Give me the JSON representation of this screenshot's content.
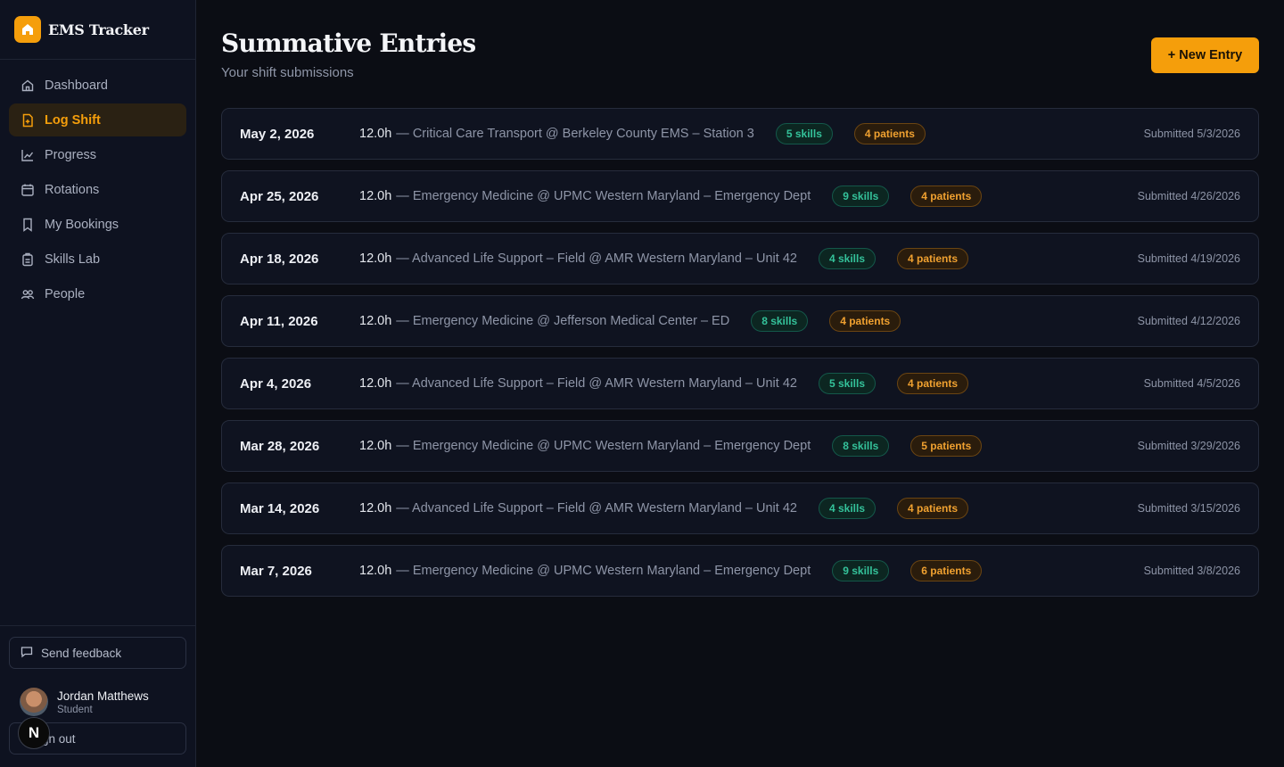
{
  "app": {
    "name": "EMS Tracker"
  },
  "sidebar": {
    "items": [
      {
        "label": "Dashboard",
        "icon": "home-icon"
      },
      {
        "label": "Log Shift",
        "icon": "file-plus-icon",
        "active": true
      },
      {
        "label": "Progress",
        "icon": "chart-line-icon"
      },
      {
        "label": "Rotations",
        "icon": "calendar-icon"
      },
      {
        "label": "My Bookings",
        "icon": "bookmark-icon"
      },
      {
        "label": "Skills Lab",
        "icon": "clipboard-icon"
      },
      {
        "label": "People",
        "icon": "users-icon"
      }
    ],
    "feedback_label": "Send feedback",
    "user": {
      "name": "Jordan Matthews",
      "role": "Student"
    },
    "signout_label": "gn out",
    "badge_letter": "N"
  },
  "header": {
    "title": "Summative Entries",
    "subtitle": "Your shift submissions",
    "new_button": "+ New Entry"
  },
  "entries": [
    {
      "date": "May 2, 2026",
      "hours": "12.0h",
      "desc": "— Critical Care Transport @ Berkeley County EMS – Station 3",
      "skills": "5 skills",
      "patients": "4 patients",
      "submitted": "Submitted 5/3/2026"
    },
    {
      "date": "Apr 25, 2026",
      "hours": "12.0h",
      "desc": "— Emergency Medicine @ UPMC Western Maryland – Emergency Dept",
      "skills": "9 skills",
      "patients": "4 patients",
      "submitted": "Submitted 4/26/2026"
    },
    {
      "date": "Apr 18, 2026",
      "hours": "12.0h",
      "desc": "— Advanced Life Support – Field @ AMR Western Maryland – Unit 42",
      "skills": "4 skills",
      "patients": "4 patients",
      "submitted": "Submitted 4/19/2026"
    },
    {
      "date": "Apr 11, 2026",
      "hours": "12.0h",
      "desc": "— Emergency Medicine @ Jefferson Medical Center – ED",
      "skills": "8 skills",
      "patients": "4 patients",
      "submitted": "Submitted 4/12/2026"
    },
    {
      "date": "Apr 4, 2026",
      "hours": "12.0h",
      "desc": "— Advanced Life Support – Field @ AMR Western Maryland – Unit 42",
      "skills": "5 skills",
      "patients": "4 patients",
      "submitted": "Submitted 4/5/2026"
    },
    {
      "date": "Mar 28, 2026",
      "hours": "12.0h",
      "desc": "— Emergency Medicine @ UPMC Western Maryland – Emergency Dept",
      "skills": "8 skills",
      "patients": "5 patients",
      "submitted": "Submitted 3/29/2026"
    },
    {
      "date": "Mar 14, 2026",
      "hours": "12.0h",
      "desc": "— Advanced Life Support – Field @ AMR Western Maryland – Unit 42",
      "skills": "4 skills",
      "patients": "4 patients",
      "submitted": "Submitted 3/15/2026"
    },
    {
      "date": "Mar 7, 2026",
      "hours": "12.0h",
      "desc": "— Emergency Medicine @ UPMC Western Maryland – Emergency Dept",
      "skills": "9 skills",
      "patients": "6 patients",
      "submitted": "Submitted 3/8/2026"
    }
  ],
  "colors": {
    "accent": "#f59e0b",
    "skills": "#34c29a",
    "background": "#0b0d14"
  }
}
